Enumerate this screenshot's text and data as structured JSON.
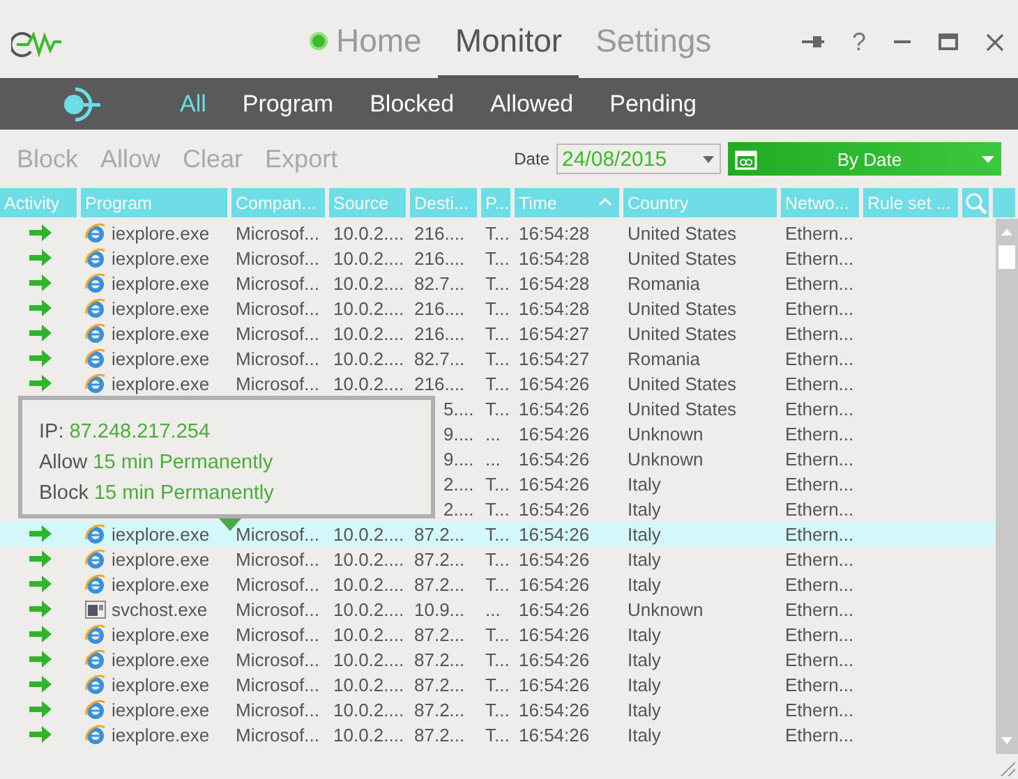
{
  "title_tabs": [
    {
      "label": "Home",
      "selected": false,
      "dot": true
    },
    {
      "label": "Monitor",
      "selected": true,
      "dot": false
    },
    {
      "label": "Settings",
      "selected": false,
      "dot": false
    }
  ],
  "window_buttons": {
    "help": "?"
  },
  "filter_tabs": [
    {
      "label": "All",
      "selected": true
    },
    {
      "label": "Program",
      "selected": false
    },
    {
      "label": "Blocked",
      "selected": false
    },
    {
      "label": "Allowed",
      "selected": false
    },
    {
      "label": "Pending",
      "selected": false
    }
  ],
  "actions": [
    {
      "label": "Block",
      "disabled": true
    },
    {
      "label": "Allow",
      "disabled": true
    },
    {
      "label": "Clear",
      "disabled": true
    },
    {
      "label": "Export",
      "disabled": true
    }
  ],
  "date": {
    "label": "Date",
    "value": "24/08/2015"
  },
  "view_button": {
    "label": "By Date"
  },
  "table": {
    "columns": [
      {
        "label": "Activity",
        "sorted": false
      },
      {
        "label": "Program",
        "sorted": false
      },
      {
        "label": "Compan...",
        "sorted": false
      },
      {
        "label": "Source",
        "sorted": false
      },
      {
        "label": "Desti...",
        "sorted": false
      },
      {
        "label": "P...",
        "sorted": false
      },
      {
        "label": "Time",
        "sorted": true
      },
      {
        "label": "Country",
        "sorted": false
      },
      {
        "label": "Netwo...",
        "sorted": false
      },
      {
        "label": "Rule set ...",
        "sorted": false
      }
    ],
    "rows": [
      {
        "kind": "browser",
        "selected": false,
        "program": "iexplore.exe",
        "company": "Microsof...",
        "source": "10.0.2....",
        "destination": "216....",
        "protocol": "T...",
        "time": "16:54:28",
        "country": "United States",
        "network": "Ethern..."
      },
      {
        "kind": "browser",
        "selected": false,
        "program": "iexplore.exe",
        "company": "Microsof...",
        "source": "10.0.2....",
        "destination": "216....",
        "protocol": "T...",
        "time": "16:54:28",
        "country": "United States",
        "network": "Ethern..."
      },
      {
        "kind": "browser",
        "selected": false,
        "program": "iexplore.exe",
        "company": "Microsof...",
        "source": "10.0.2....",
        "destination": "82.7...",
        "protocol": "T...",
        "time": "16:54:28",
        "country": "Romania",
        "network": "Ethern..."
      },
      {
        "kind": "browser",
        "selected": false,
        "program": "iexplore.exe",
        "company": "Microsof...",
        "source": "10.0.2....",
        "destination": "216....",
        "protocol": "T...",
        "time": "16:54:28",
        "country": "United States",
        "network": "Ethern..."
      },
      {
        "kind": "browser",
        "selected": false,
        "program": "iexplore.exe",
        "company": "Microsof...",
        "source": "10.0.2....",
        "destination": "216....",
        "protocol": "T...",
        "time": "16:54:27",
        "country": "United States",
        "network": "Ethern..."
      },
      {
        "kind": "browser",
        "selected": false,
        "program": "iexplore.exe",
        "company": "Microsof...",
        "source": "10.0.2....",
        "destination": "82.7...",
        "protocol": "T...",
        "time": "16:54:27",
        "country": "Romania",
        "network": "Ethern..."
      },
      {
        "kind": "browser",
        "selected": false,
        "program": "iexplore.exe",
        "company": "Microsof...",
        "source": "10.0.2....",
        "destination": "216....",
        "protocol": "T...",
        "time": "16:54:26",
        "country": "United States",
        "network": "Ethern..."
      },
      {
        "kind": "covered",
        "selected": false,
        "destination": "5....",
        "protocol": "T...",
        "time": "16:54:26",
        "country": "United States",
        "network": "Ethern..."
      },
      {
        "kind": "covered",
        "selected": false,
        "destination": "9....",
        "protocol": "...",
        "time": "16:54:26",
        "country": "Unknown",
        "network": "Ethern..."
      },
      {
        "kind": "covered",
        "selected": false,
        "destination": "9....",
        "protocol": "...",
        "time": "16:54:26",
        "country": "Unknown",
        "network": "Ethern..."
      },
      {
        "kind": "covered",
        "selected": false,
        "destination": "2....",
        "protocol": "T...",
        "time": "16:54:26",
        "country": "Italy",
        "network": "Ethern..."
      },
      {
        "kind": "covered",
        "selected": false,
        "destination": "2....",
        "protocol": "T...",
        "time": "16:54:26",
        "country": "Italy",
        "network": "Ethern..."
      },
      {
        "kind": "browser",
        "selected": true,
        "program": "iexplore.exe",
        "company": "Microsof...",
        "source": "10.0.2....",
        "destination": "87.2...",
        "protocol": "T...",
        "time": "16:54:26",
        "country": "Italy",
        "network": "Ethern..."
      },
      {
        "kind": "browser",
        "selected": false,
        "program": "iexplore.exe",
        "company": "Microsof...",
        "source": "10.0.2....",
        "destination": "87.2...",
        "protocol": "T...",
        "time": "16:54:26",
        "country": "Italy",
        "network": "Ethern..."
      },
      {
        "kind": "browser",
        "selected": false,
        "program": "iexplore.exe",
        "company": "Microsof...",
        "source": "10.0.2....",
        "destination": "87.2...",
        "protocol": "T...",
        "time": "16:54:26",
        "country": "Italy",
        "network": "Ethern..."
      },
      {
        "kind": "service",
        "selected": false,
        "program": "svchost.exe",
        "company": "Microsof...",
        "source": "10.0.2....",
        "destination": "10.9...",
        "protocol": "...",
        "time": "16:54:26",
        "country": "Unknown",
        "network": "Ethern..."
      },
      {
        "kind": "browser",
        "selected": false,
        "program": "iexplore.exe",
        "company": "Microsof...",
        "source": "10.0.2....",
        "destination": "87.2...",
        "protocol": "T...",
        "time": "16:54:26",
        "country": "Italy",
        "network": "Ethern..."
      },
      {
        "kind": "browser",
        "selected": false,
        "program": "iexplore.exe",
        "company": "Microsof...",
        "source": "10.0.2....",
        "destination": "87.2...",
        "protocol": "T...",
        "time": "16:54:26",
        "country": "Italy",
        "network": "Ethern..."
      },
      {
        "kind": "browser",
        "selected": false,
        "program": "iexplore.exe",
        "company": "Microsof...",
        "source": "10.0.2....",
        "destination": "87.2...",
        "protocol": "T...",
        "time": "16:54:26",
        "country": "Italy",
        "network": "Ethern..."
      },
      {
        "kind": "browser",
        "selected": false,
        "program": "iexplore.exe",
        "company": "Microsof...",
        "source": "10.0.2....",
        "destination": "87.2...",
        "protocol": "T...",
        "time": "16:54:26",
        "country": "Italy",
        "network": "Ethern..."
      },
      {
        "kind": "browser",
        "selected": false,
        "program": "iexplore.exe",
        "company": "Microsof...",
        "source": "10.0.2....",
        "destination": "87.2...",
        "protocol": "T...",
        "time": "16:54:26",
        "country": "Italy",
        "network": "Ethern..."
      }
    ]
  },
  "tooltip": {
    "ip_label": "IP:",
    "ip": "87.248.217.254",
    "actions": [
      {
        "label": "Allow",
        "options": [
          "15 min",
          "Permanently"
        ]
      },
      {
        "label": "Block",
        "options": [
          "15 min",
          "Permanently"
        ]
      }
    ]
  }
}
